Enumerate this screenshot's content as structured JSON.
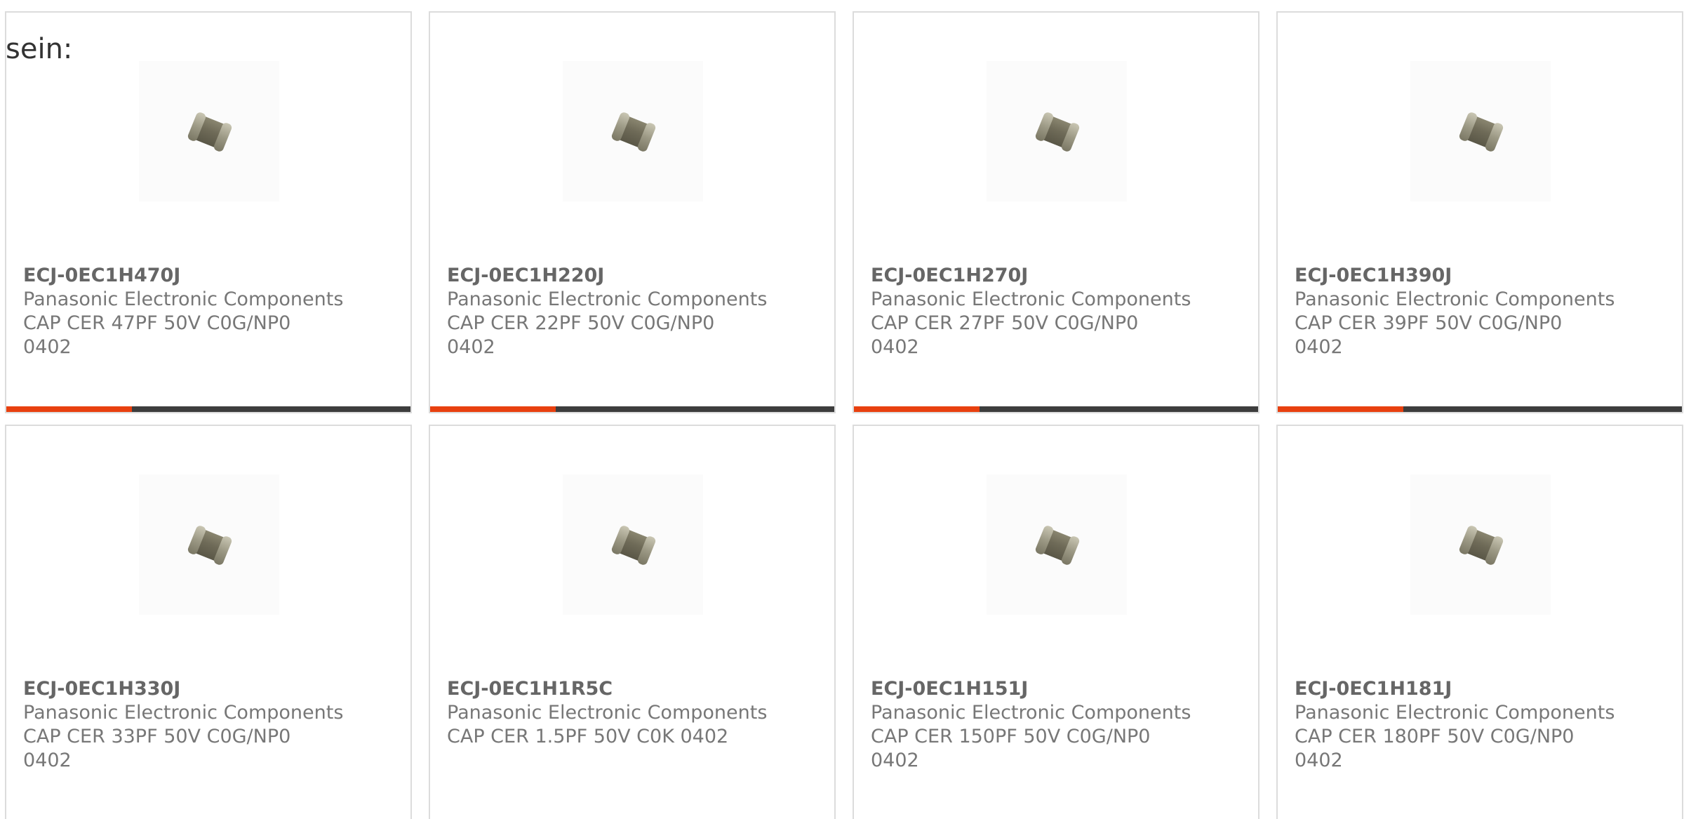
{
  "heading": "sein:",
  "colors": {
    "accent": "#e8400f",
    "bar_track": "#3d3d3d",
    "card_border": "#dcdcdc",
    "text": "#666666"
  },
  "cards": [
    {
      "part_number": "ECJ-0EC1H470J",
      "manufacturer": "Panasonic Electronic Components",
      "description": "CAP CER 47PF 50V C0G/NP0 0402",
      "image_icon": "capacitor-chip-icon",
      "progress": 0.31
    },
    {
      "part_number": "ECJ-0EC1H220J",
      "manufacturer": "Panasonic Electronic Components",
      "description": "CAP CER 22PF 50V C0G/NP0 0402",
      "image_icon": "capacitor-chip-icon",
      "progress": 0.31
    },
    {
      "part_number": "ECJ-0EC1H270J",
      "manufacturer": "Panasonic Electronic Components",
      "description": "CAP CER 27PF 50V C0G/NP0 0402",
      "image_icon": "capacitor-chip-icon",
      "progress": 0.31
    },
    {
      "part_number": "ECJ-0EC1H390J",
      "manufacturer": "Panasonic Electronic Components",
      "description": "CAP CER 39PF 50V C0G/NP0 0402",
      "image_icon": "capacitor-chip-icon",
      "progress": 0.31
    },
    {
      "part_number": "ECJ-0EC1H330J",
      "manufacturer": "Panasonic Electronic Components",
      "description": "CAP CER 33PF 50V C0G/NP0 0402",
      "image_icon": "capacitor-chip-icon"
    },
    {
      "part_number": "ECJ-0EC1H1R5C",
      "manufacturer": "Panasonic Electronic Components",
      "description": "CAP CER 1.5PF 50V C0K 0402",
      "image_icon": "capacitor-chip-icon"
    },
    {
      "part_number": "ECJ-0EC1H151J",
      "manufacturer": "Panasonic Electronic Components",
      "description": "CAP CER 150PF 50V C0G/NP0 0402",
      "image_icon": "capacitor-chip-icon"
    },
    {
      "part_number": "ECJ-0EC1H181J",
      "manufacturer": "Panasonic Electronic Components",
      "description": "CAP CER 180PF 50V C0G/NP0 0402",
      "image_icon": "capacitor-chip-icon"
    }
  ]
}
